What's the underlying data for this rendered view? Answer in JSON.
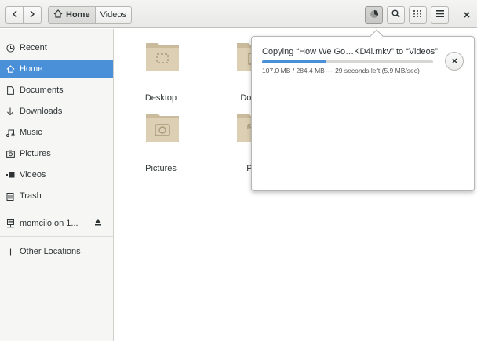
{
  "header": {
    "back_icon": "back-icon",
    "forward_icon": "forward-icon",
    "path_home": "Home",
    "path_videos": "Videos",
    "tools": [
      "operations-icon",
      "search-icon",
      "view-grid-icon",
      "menu-icon"
    ],
    "close_icon": "close-icon"
  },
  "sidebar": {
    "items": [
      {
        "label": "Recent",
        "icon": "clock-icon"
      },
      {
        "label": "Home",
        "icon": "home-icon"
      },
      {
        "label": "Documents",
        "icon": "document-icon"
      },
      {
        "label": "Downloads",
        "icon": "download-icon"
      },
      {
        "label": "Music",
        "icon": "music-icon"
      },
      {
        "label": "Pictures",
        "icon": "camera-icon"
      },
      {
        "label": "Videos",
        "icon": "video-icon"
      },
      {
        "label": "Trash",
        "icon": "trash-icon"
      },
      {
        "label": "momcilo on 1...",
        "icon": "network-drive-icon"
      },
      {
        "label": "Other Locations",
        "icon": "plus-icon"
      }
    ],
    "selected": "Home"
  },
  "main": {
    "folders": [
      {
        "label": "Desktop"
      },
      {
        "label": "Docur"
      },
      {
        "label": "Pictures"
      },
      {
        "label": "Pu"
      }
    ]
  },
  "operation": {
    "title": "Copying “How We Go…KD4l.mkv” to “Videos”",
    "detail": "107.0 MB / 284.4 MB — 29 seconds left (5.9 MB/sec)",
    "progress": 0.376
  },
  "colors": {
    "accent": "#4a90d9",
    "folder": "#d8cdb4"
  }
}
